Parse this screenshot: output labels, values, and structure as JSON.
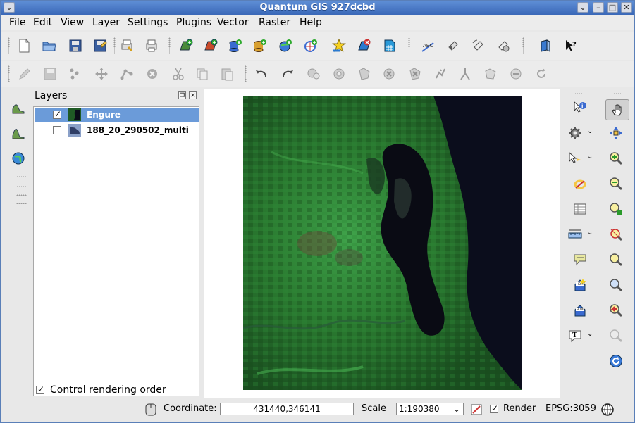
{
  "window": {
    "title": "Quantum GIS 927dcbd"
  },
  "menu": [
    "File",
    "Edit",
    "View",
    "Layer",
    "Settings",
    "Plugins",
    "Vector",
    "Raster",
    "Help"
  ],
  "layers_panel": {
    "title": "Layers",
    "layers": [
      {
        "name": "Engure",
        "checked": true,
        "selected": true
      },
      {
        "name": "188_20_290502_multi",
        "checked": false,
        "selected": false
      }
    ],
    "control_rendering_label": "Control rendering order",
    "control_rendering_checked": true
  },
  "status": {
    "coordinate_label": "Coordinate:",
    "coordinate_value": "431440,346141",
    "scale_label": "Scale",
    "scale_value": "1:190380",
    "render_label": "Render",
    "render_checked": true,
    "epsg": "EPSG:3059"
  },
  "colors": {
    "title_bar": "#4a78c4",
    "selection": "#6b9bd9",
    "map_water": "#0b0d1c",
    "map_land": "#1f6a25"
  }
}
